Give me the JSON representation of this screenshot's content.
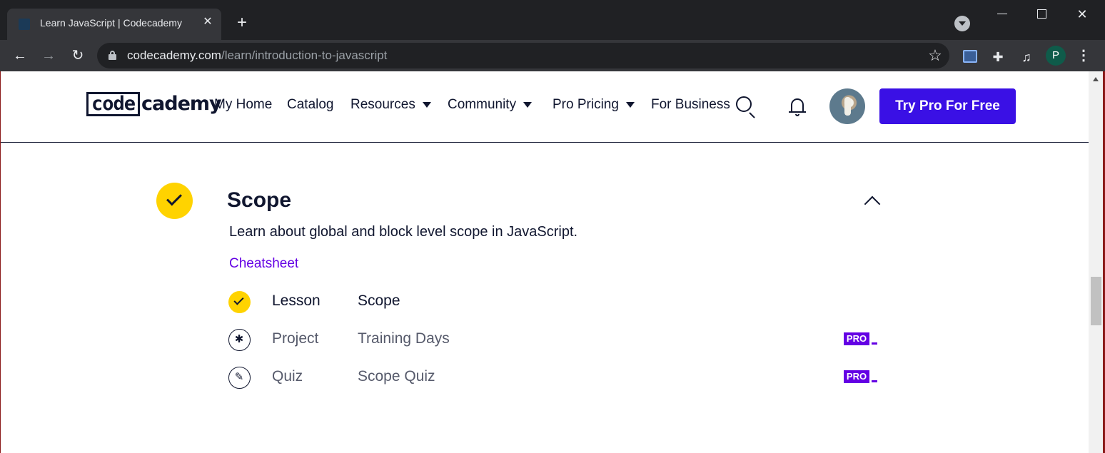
{
  "browser": {
    "tab_title": "Learn JavaScript | Codecademy",
    "tab_close": "✕",
    "new_tab": "+",
    "url_domain": "codecademy.com",
    "url_path": "/learn/introduction-to-javascript",
    "profile_initial": "P",
    "icons": {
      "back": "←",
      "forward": "→",
      "reload": "↻",
      "star": "☆",
      "puzzle": "✚",
      "media": "♫",
      "menu": "⋮",
      "minimize": "",
      "maximize": "",
      "close": "✕"
    }
  },
  "site_header": {
    "logo_code": "code",
    "logo_academy": "cademy",
    "nav": [
      {
        "label": "My Home"
      },
      {
        "label": "Catalog"
      },
      {
        "label": "Resources"
      },
      {
        "label": "Community"
      },
      {
        "label": "Pro Pricing"
      },
      {
        "label": "For Business"
      }
    ],
    "cta_label": "Try Pro For Free",
    "colors": {
      "brand_navy": "#10162f",
      "cta_blue": "#3a10e5"
    }
  },
  "module": {
    "title": "Scope",
    "description": "Learn about global and block level scope in JavaScript.",
    "cheatsheet_label": "Cheatsheet",
    "completed": true,
    "items": [
      {
        "type": "Lesson",
        "title": "Scope",
        "icon": "check-icon",
        "completed": true,
        "pro": ""
      },
      {
        "type": "Project",
        "title": "Training Days",
        "icon": "puzzle-icon",
        "completed": false,
        "pro": "PRO"
      },
      {
        "type": "Quiz",
        "title": "Scope Quiz",
        "icon": "quiz-icon",
        "completed": false,
        "pro": "PRO"
      }
    ],
    "colors": {
      "check_yellow": "#ffd300",
      "pro_purple": "#6400e4",
      "link_purple": "#6400e4"
    }
  }
}
